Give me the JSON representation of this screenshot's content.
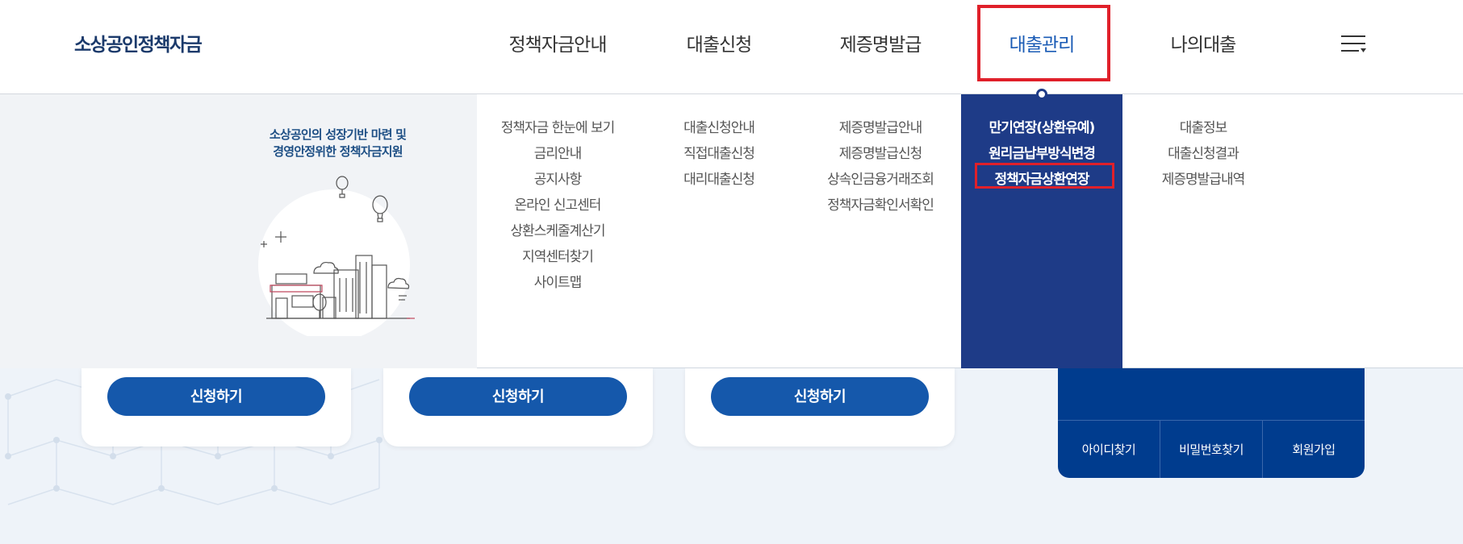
{
  "logo": {
    "text": "소상공인정책자금"
  },
  "gnb": [
    {
      "label": "정책자금안내"
    },
    {
      "label": "대출신청"
    },
    {
      "label": "제증명발급"
    },
    {
      "label": "대출관리",
      "active": true
    },
    {
      "label": "나의대출"
    }
  ],
  "slogan": {
    "line1": "소상공인의 성장기반 마련 및",
    "line2": "경영안정위한 정책자금지원"
  },
  "submenu": [
    {
      "items": [
        "정책자금 한눈에 보기",
        "금리안내",
        "공지사항",
        "온라인 신고센터",
        "상환스케줄계산기",
        "지역센터찾기",
        "사이트맵"
      ]
    },
    {
      "items": [
        "대출신청안내",
        "직접대출신청",
        "대리대출신청"
      ]
    },
    {
      "items": [
        "제증명발급안내",
        "제증명발급신청",
        "상속인금융거래조회",
        "정책자금확인서확인"
      ]
    },
    {
      "items": [
        "만기연장(상환유예)",
        "원리금납부방식변경",
        "정책자금상환연장"
      ],
      "active": true
    },
    {
      "items": [
        "대출정보",
        "대출신청결과",
        "제증명발급내역"
      ]
    }
  ],
  "cards": [
    {
      "button": "신청하기"
    },
    {
      "button": "신청하기"
    },
    {
      "button": "신청하기"
    }
  ],
  "login_links": [
    "아이디찾기",
    "비밀번호찾기",
    "회원가입"
  ],
  "colors": {
    "brand_navy": "#1e3b87",
    "accent_blue": "#1a5bb5",
    "button_blue": "#1558ab",
    "highlight_red": "#e0202a",
    "login_bg": "#003c8e"
  },
  "icons": [
    "hamburger-menu-icon",
    "city-illustration"
  ]
}
